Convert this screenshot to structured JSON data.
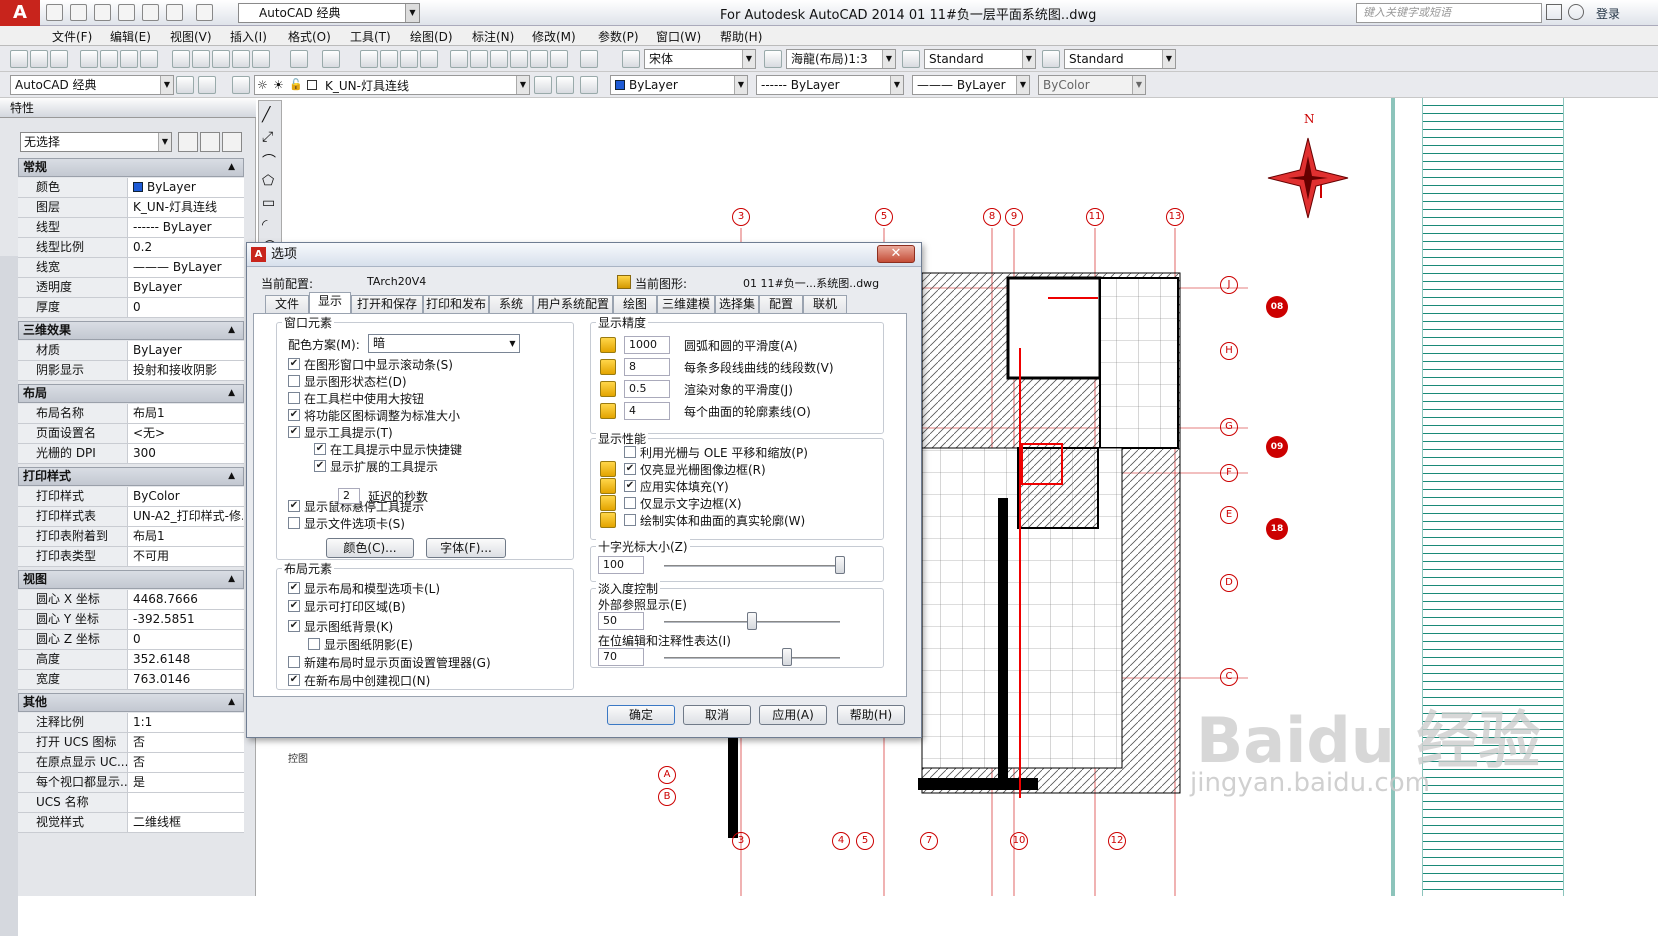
{
  "title_bar": {
    "logo": "A",
    "workspace": "AutoCAD 经典",
    "window_title": "For Autodesk AutoCAD 2014    01 11#负一层平面系统图..dwg",
    "search_placeholder": "键入关键字或短语",
    "login": "登录"
  },
  "menu": [
    "文件(F)",
    "编辑(E)",
    "视图(V)",
    "插入(I)",
    "格式(O)",
    "工具(T)",
    "绘图(D)",
    "标注(N)",
    "修改(M)",
    "参数(P)",
    "窗口(W)",
    "帮助(H)"
  ],
  "toolbar": {
    "font": "宋体",
    "dim_scale": "海龍(布局)1:3",
    "text_style": "Standard",
    "table_style": "Standard",
    "workspace2": "AutoCAD 经典",
    "layer": "K_UN-灯具连线",
    "color": "ByLayer",
    "linetype": "------ ByLayer",
    "lineweight": "——— ByLayer",
    "plotstyle": "ByColor"
  },
  "properties": {
    "title": "特性",
    "selection": "无选择",
    "sections": [
      {
        "name": "常规",
        "rows": [
          [
            "颜色",
            "ByLayer"
          ],
          [
            "图层",
            "K_UN-灯具连线"
          ],
          [
            "线型",
            "------ ByLayer"
          ],
          [
            "线型比例",
            "0.2"
          ],
          [
            "线宽",
            "——— ByLayer"
          ],
          [
            "透明度",
            "ByLayer"
          ],
          [
            "厚度",
            "0"
          ]
        ]
      },
      {
        "name": "三维效果",
        "rows": [
          [
            "材质",
            "ByLayer"
          ],
          [
            "阴影显示",
            "投射和接收阴影"
          ]
        ]
      },
      {
        "name": "布局",
        "rows": [
          [
            "布局名称",
            "布局1"
          ],
          [
            "页面设置名",
            "<无>"
          ],
          [
            "光栅的 DPI",
            "300"
          ]
        ]
      },
      {
        "name": "打印样式",
        "rows": [
          [
            "打印样式",
            "ByColor"
          ],
          [
            "打印样式表",
            "UN-A2_打印样式-修..."
          ],
          [
            "打印表附着到",
            "布局1"
          ],
          [
            "打印表类型",
            "不可用"
          ]
        ]
      },
      {
        "name": "视图",
        "rows": [
          [
            "圆心 X 坐标",
            "4468.7666"
          ],
          [
            "圆心 Y 坐标",
            "-392.5851"
          ],
          [
            "圆心 Z 坐标",
            "0"
          ],
          [
            "高度",
            "352.6148"
          ],
          [
            "宽度",
            "763.0146"
          ]
        ]
      },
      {
        "name": "其他",
        "rows": [
          [
            "注释比例",
            "1:1"
          ],
          [
            "打开 UCS 图标",
            "否"
          ],
          [
            "在原点显示 UC...",
            "否"
          ],
          [
            "每个视口都显示...",
            "是"
          ],
          [
            "UCS 名称",
            ""
          ],
          [
            "视觉样式",
            "二维线框"
          ]
        ]
      }
    ]
  },
  "dialog": {
    "title": "选项",
    "current_profile_label": "当前配置:",
    "current_profile": "TArch20V4",
    "current_drawing_label": "当前图形:",
    "current_drawing": "01 11#负一...系统图..dwg",
    "tabs": [
      "文件",
      "显示",
      "打开和保存",
      "打印和发布",
      "系统",
      "用户系统配置",
      "绘图",
      "三维建模",
      "选择集",
      "配置",
      "联机"
    ],
    "active_tab": "显示",
    "window_elements": {
      "title": "窗口元素",
      "scheme_label": "配色方案(M):",
      "scheme_value": "暗",
      "checks": [
        [
          "在图形窗口中显示滚动条(S)",
          true
        ],
        [
          "显示图形状态栏(D)",
          false
        ],
        [
          "在工具栏中使用大按钮",
          false
        ],
        [
          "将功能区图标调整为标准大小",
          true
        ],
        [
          "显示工具提示(T)",
          true
        ],
        [
          "在工具提示中显示快捷键",
          true
        ],
        [
          "显示扩展的工具提示",
          true
        ],
        [
          "显示鼠标悬停工具提示",
          true
        ],
        [
          "显示文件选项卡(S)",
          false
        ]
      ],
      "delay_value": "2",
      "delay_label": "延迟的秒数",
      "colors_btn": "颜色(C)...",
      "fonts_btn": "字体(F)..."
    },
    "layout_elements": {
      "title": "布局元素",
      "checks": [
        [
          "显示布局和模型选项卡(L)",
          true
        ],
        [
          "显示可打印区域(B)",
          true
        ],
        [
          "显示图纸背景(K)",
          true
        ],
        [
          "显示图纸阴影(E)",
          false
        ],
        [
          "新建布局时显示页面设置管理器(G)",
          false
        ],
        [
          "在新布局中创建视口(N)",
          true
        ]
      ]
    },
    "display_resolution": {
      "title": "显示精度",
      "items": [
        [
          "1000",
          "圆弧和圆的平滑度(A)"
        ],
        [
          "8",
          "每条多段线曲线的线段数(V)"
        ],
        [
          "0.5",
          "渲染对象的平滑度(J)"
        ],
        [
          "4",
          "每个曲面的轮廓素线(O)"
        ]
      ]
    },
    "display_performance": {
      "title": "显示性能",
      "checks": [
        [
          "利用光栅与 OLE 平移和缩放(P)",
          false
        ],
        [
          "仅亮显光栅图像边框(R)",
          true
        ],
        [
          "应用实体填充(Y)",
          true
        ],
        [
          "仅显示文字边框(X)",
          false
        ],
        [
          "绘制实体和曲面的真实轮廓(W)",
          false
        ]
      ]
    },
    "crosshair": {
      "title": "十字光标大小(Z)",
      "value": "100",
      "fraction": 1.0
    },
    "fade": {
      "title": "淡入度控制",
      "xref_label": "外部参照显示(E)",
      "xref_value": "50",
      "xref_fraction": 0.5,
      "inplace_label": "在位编辑和注释性表达(I)",
      "inplace_value": "70",
      "inplace_fraction": 0.7
    },
    "buttons": [
      "确定",
      "取消",
      "应用(A)",
      "帮助(H)"
    ]
  },
  "drawing": {
    "north": "N",
    "grid_top": [
      "3",
      "5",
      "8",
      "9",
      "11",
      "13"
    ],
    "grid_bottom": [
      "3",
      "4",
      "5",
      "7",
      "10",
      "12"
    ],
    "grid_right": [
      "J",
      "H",
      "G",
      "F",
      "E",
      "D",
      "C"
    ],
    "grid_left": [
      "A",
      "B"
    ],
    "callouts": [
      "08",
      "09",
      "18"
    ],
    "layout_tab_text": "控图"
  },
  "watermark": {
    "main": "Baidu 经验",
    "sub": "jingyan.baidu.com"
  }
}
